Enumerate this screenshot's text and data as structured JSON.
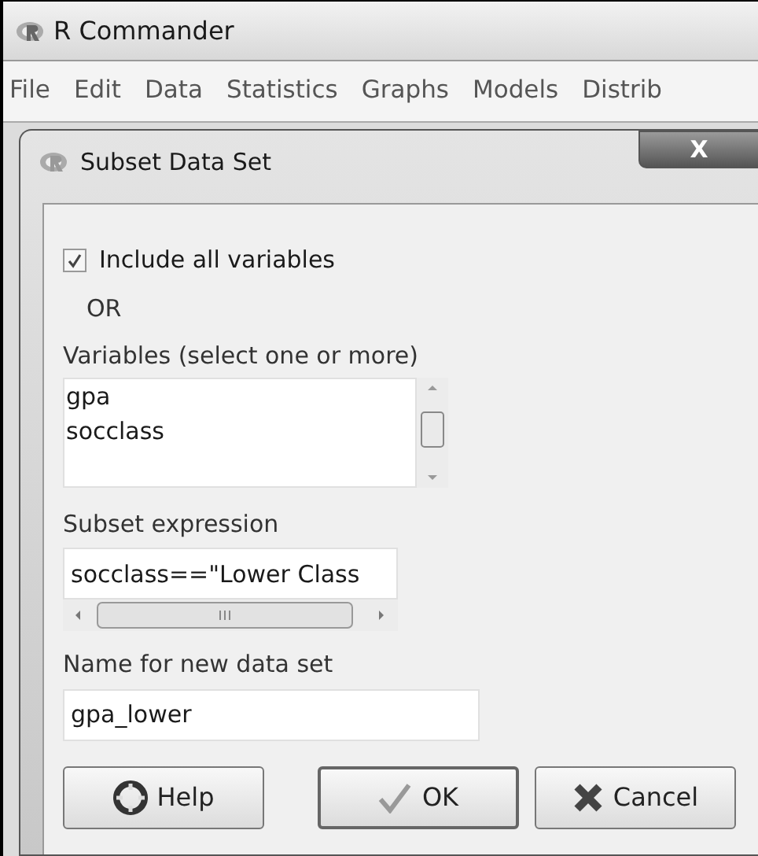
{
  "window": {
    "title": "R Commander"
  },
  "menu": [
    "File",
    "Edit",
    "Data",
    "Statistics",
    "Graphs",
    "Models",
    "Distrib"
  ],
  "dialog": {
    "title": "Subset Data Set",
    "close_label": "X",
    "include_all": {
      "label": "Include all variables",
      "checked": true
    },
    "or_label": "OR",
    "variables": {
      "label": "Variables (select one or more)",
      "items": [
        "gpa",
        "socclass"
      ]
    },
    "subset": {
      "label": "Subset expression",
      "value": "socclass==\"Lower Class"
    },
    "new_name": {
      "label": "Name for new data set",
      "value": "gpa_lower"
    },
    "buttons": [
      {
        "kind": "help",
        "label": "Help"
      },
      {
        "kind": "ok",
        "label": "OK"
      },
      {
        "kind": "cancel",
        "label": "Cancel"
      }
    ]
  }
}
